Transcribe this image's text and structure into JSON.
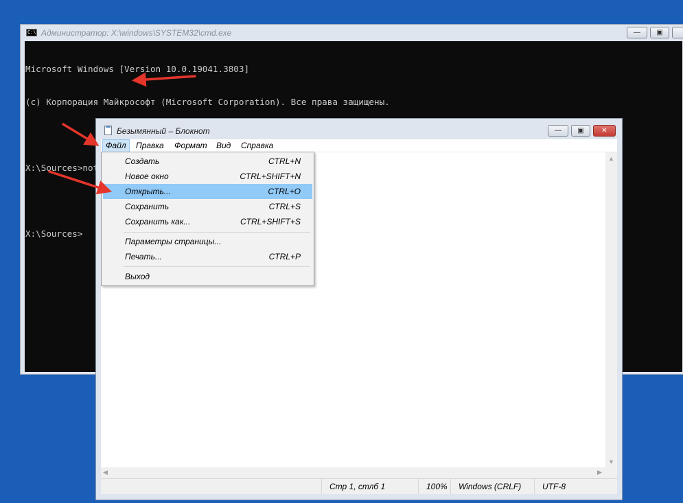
{
  "cmd": {
    "icon_label": "C:\\",
    "title": "Администратор: X:\\windows\\SYSTEM32\\cmd.exe",
    "lines": [
      "Microsoft Windows [Version 10.0.19041.3803]",
      "(c) Корпорация Майкрософт (Microsoft Corporation). Все права защищены.",
      "",
      "X:\\Sources>notepad",
      "",
      "X:\\Sources>"
    ],
    "buttons": {
      "minimize": "—",
      "maximize": "▣"
    }
  },
  "notepad": {
    "title": "Безымянный – Блокнот",
    "buttons": {
      "minimize": "—",
      "maximize": "▣",
      "close": "✕"
    },
    "menu": [
      "Файл",
      "Правка",
      "Формат",
      "Вид",
      "Справка"
    ],
    "status": {
      "position": "Стр 1, стлб 1",
      "zoom": "100%",
      "line_endings": "Windows (CRLF)",
      "encoding": "UTF-8"
    },
    "scroll_icons": {
      "up": "▲",
      "down": "▼",
      "left": "◀",
      "right": "▶"
    }
  },
  "file_menu": {
    "items": [
      {
        "label": "Создать",
        "shortcut": "CTRL+N"
      },
      {
        "label": "Новое окно",
        "shortcut": "CTRL+SHIFT+N"
      },
      {
        "label": "Открыть...",
        "shortcut": "CTRL+O",
        "highlighted": true
      },
      {
        "label": "Сохранить",
        "shortcut": "CTRL+S"
      },
      {
        "label": "Сохранить как...",
        "shortcut": "CTRL+SHIFT+S"
      },
      {
        "label": "Параметры страницы...",
        "shortcut": ""
      },
      {
        "label": "Печать...",
        "shortcut": "CTRL+P"
      },
      {
        "label": "Выход",
        "shortcut": ""
      }
    ]
  },
  "colors": {
    "desktop": "#1a5eb8",
    "console_bg": "#0c0c0c",
    "console_text": "#cccccc",
    "menu_highlight": "#91c9f7",
    "arrow": "#e5352b",
    "close_button": "#c9403a"
  }
}
